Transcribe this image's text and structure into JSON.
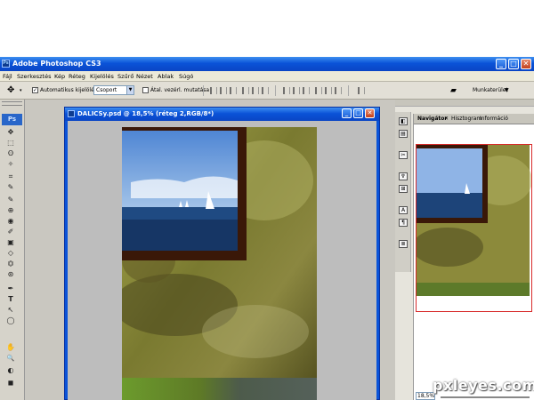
{
  "app": {
    "title": "Adobe Photoshop CS3",
    "icon_label": "Ps",
    "window_buttons": {
      "minimize": "_",
      "maximize": "□",
      "close": "✕"
    }
  },
  "menu": {
    "items": [
      "Fájl",
      "Szerkesztés",
      "Kép",
      "Réteg",
      "Kijelölés",
      "Szűrő",
      "Nézet",
      "Ablak",
      "Súgó"
    ]
  },
  "options": {
    "move_glyph": "✥",
    "auto_select_label": "Automatikus kijelölés:",
    "auto_select_checked": "✓",
    "group_select_value": "Csoport",
    "transform_label": "Átal. vezérl. mutatása",
    "workspace_label": "Munkaterület"
  },
  "toolbox": {
    "logo": "Ps",
    "tools": [
      "✥",
      "⬚",
      "ʘ",
      "✧",
      "⌗",
      "✎",
      "✎",
      "⊕",
      "◉",
      "✐",
      "▣",
      "◇",
      "⏣",
      "⊛",
      "✒",
      "T",
      "↖",
      "◯",
      "✋",
      "🔍",
      "◐",
      "◼"
    ]
  },
  "document": {
    "title": "DALICSy.psd @ 18,5% (réteg 2,RGB/8*)",
    "colors": {
      "sky_top": "#5f92d9",
      "sea": "#173a6d",
      "frame": "#3a1808",
      "texture": "#8c8a3b"
    }
  },
  "dock": {
    "icons": [
      "◧",
      "▤",
      "✂",
      "♆",
      "⊞",
      "A",
      "¶",
      "≣"
    ]
  },
  "panel": {
    "tabs": [
      "Navigátor",
      "Hisztogram",
      "Információ"
    ],
    "close_glyph": "✕",
    "zoom_value": "18,5%",
    "highlight_color": "#d82a2a"
  },
  "watermark": "pxleyes.com"
}
